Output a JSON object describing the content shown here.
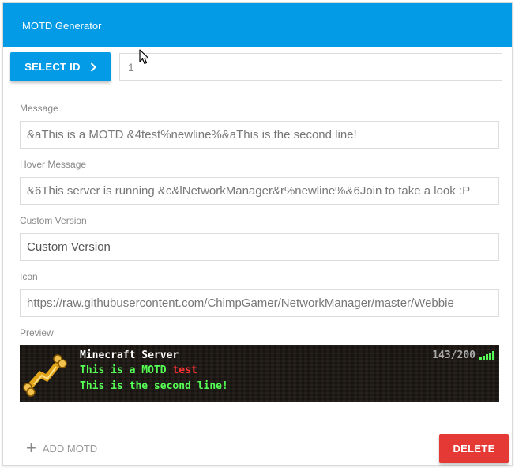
{
  "header": {
    "title": "MOTD Generator"
  },
  "select_id": {
    "label": "SELECT ID",
    "value": "1"
  },
  "fields": {
    "message": {
      "label": "Message",
      "value": "&aThis is a MOTD &4test%newline%&aThis is the second line!"
    },
    "hover_message": {
      "label": "Hover Message",
      "value": "&6This server is running &c&lNetworkManager&r%newline%&6Join to take a look :P"
    },
    "custom_version": {
      "label": "Custom Version",
      "placeholder": "Custom Version"
    },
    "icon": {
      "label": "Icon",
      "value": "https://raw.githubusercontent.com/ChimpGamer/NetworkManager/master/Webbie"
    }
  },
  "preview": {
    "label": "Preview",
    "server_name": "Minecraft Server",
    "line1_a": "This is a MOTD ",
    "line1_b": "test",
    "line2": "This is the second line!",
    "players": "143/200",
    "icons": {
      "server": "golden-bones-icon",
      "signal": "signal-bars-icon"
    }
  },
  "actions": {
    "add_motd": "ADD MOTD",
    "delete": "DELETE"
  },
  "colors": {
    "header": "#039be5",
    "primary": "#039be5",
    "danger": "#e53935",
    "mc_green": "#55ff55",
    "mc_red": "#ff3333"
  }
}
